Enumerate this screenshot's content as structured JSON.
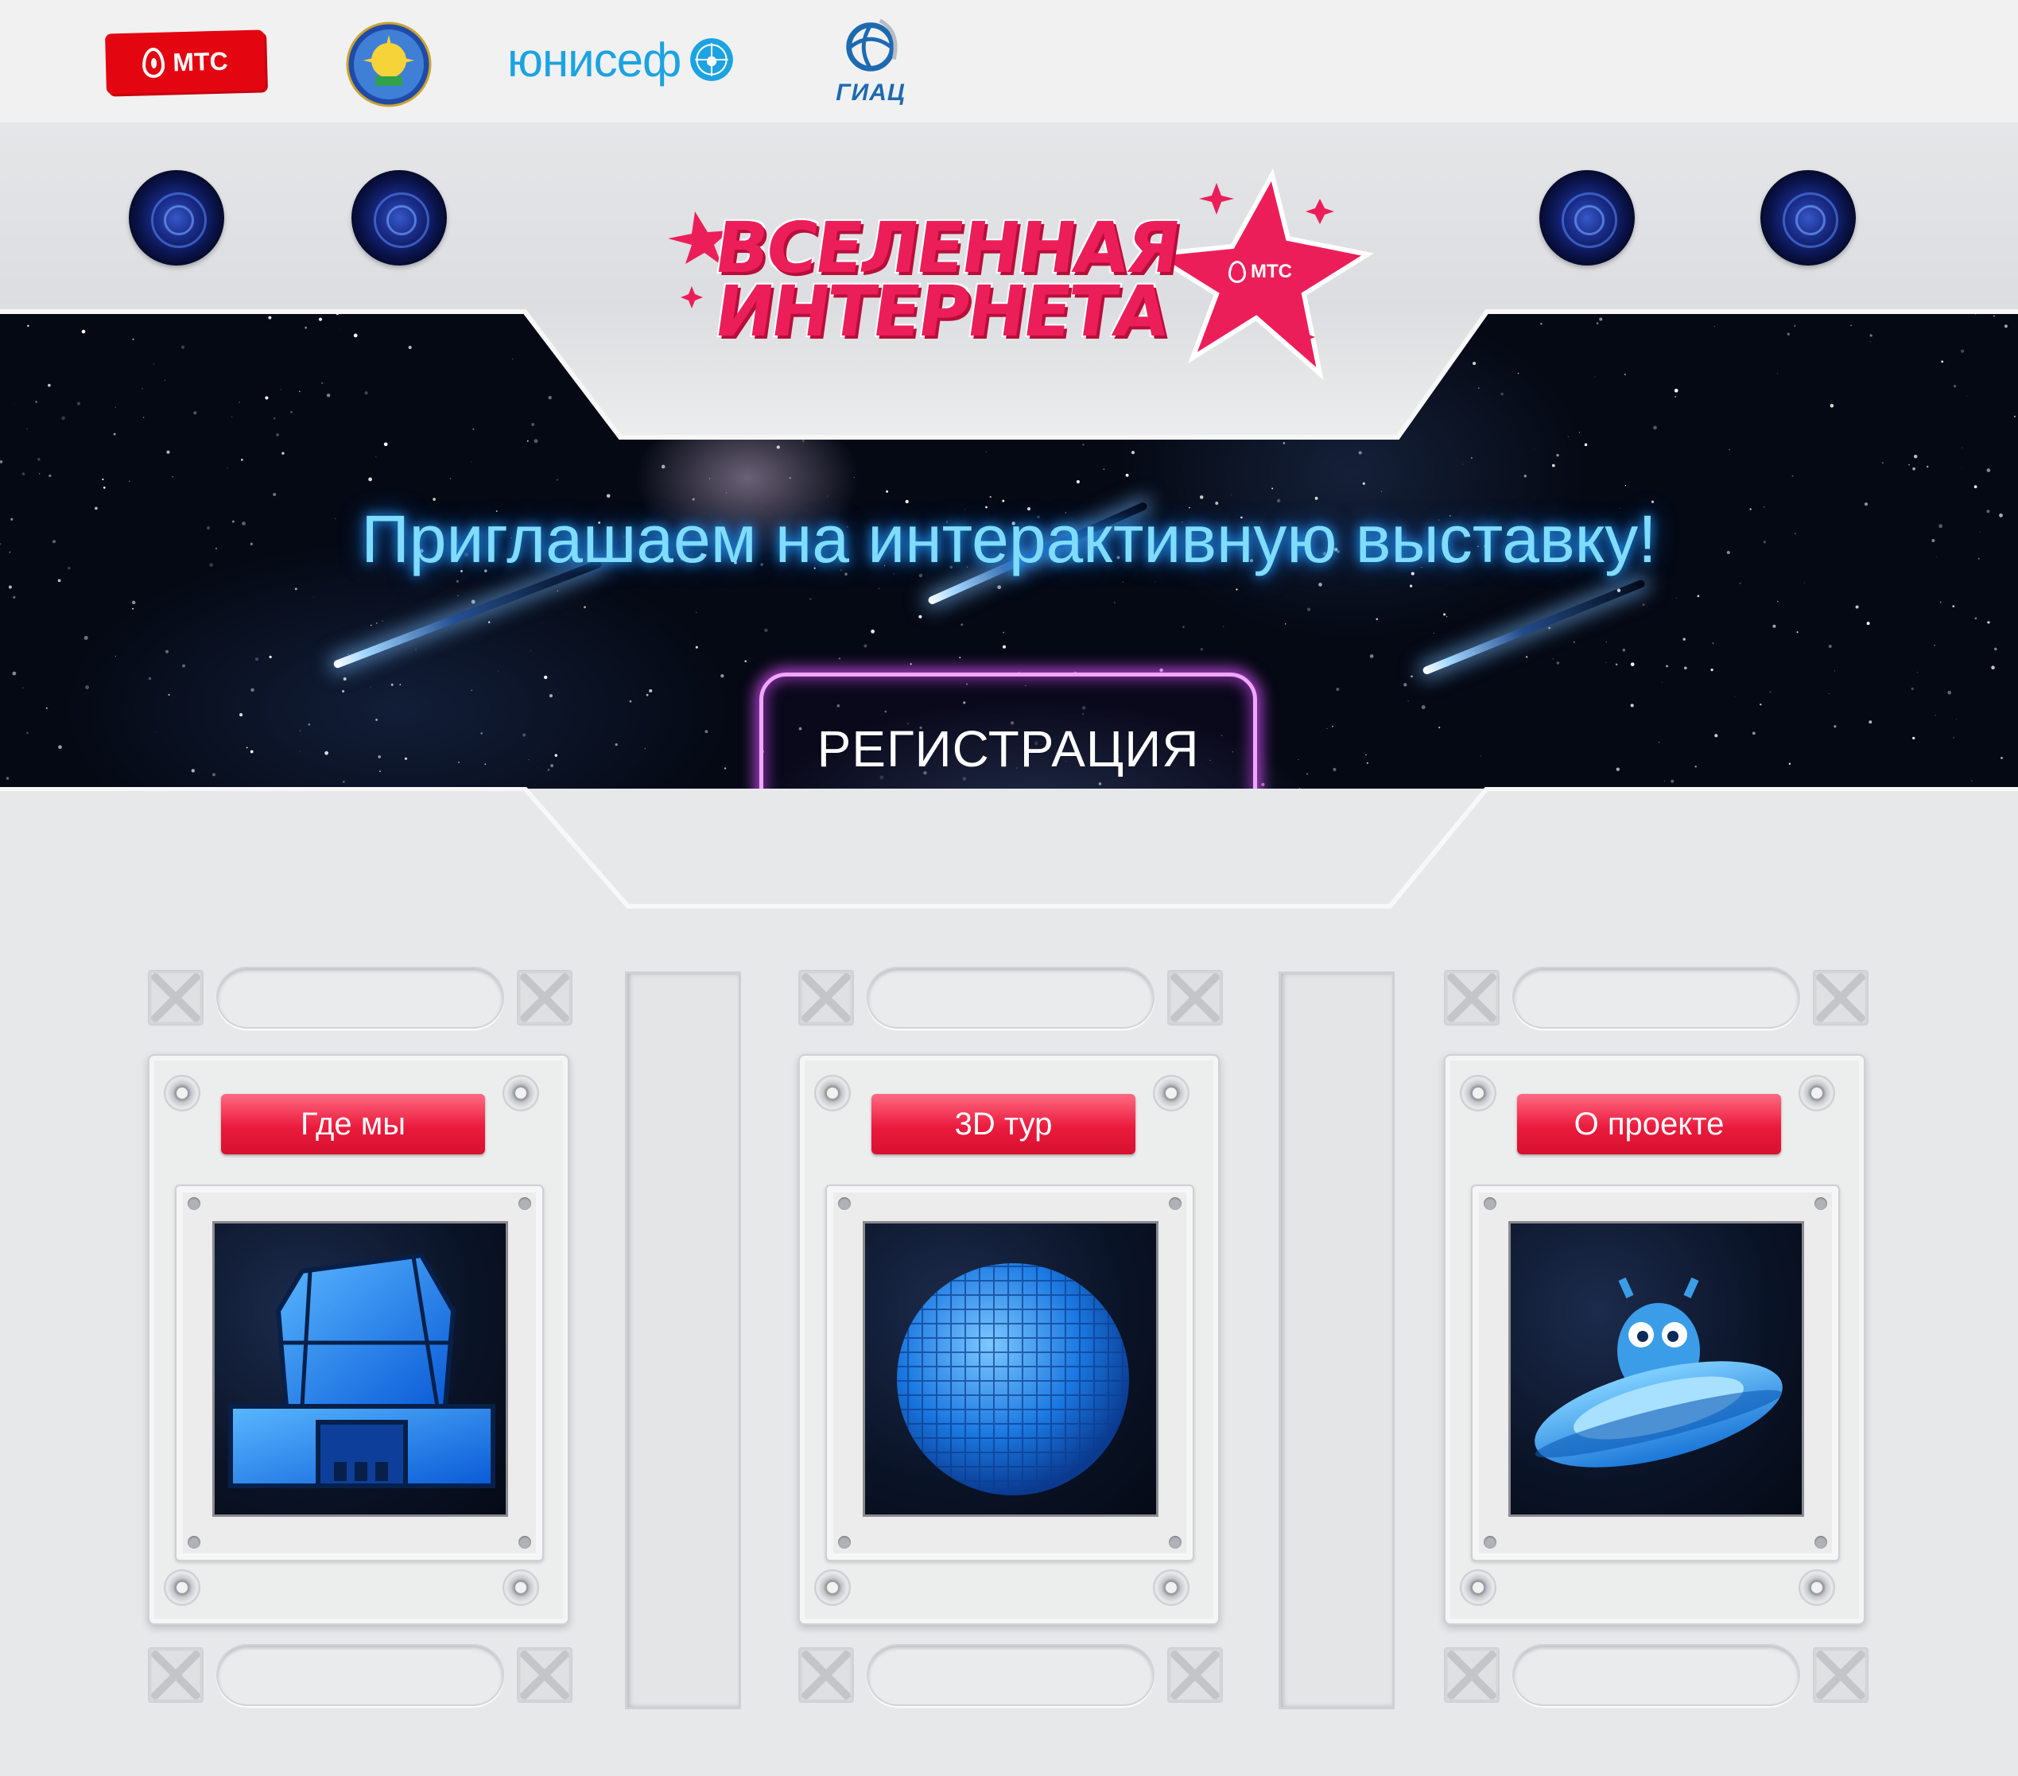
{
  "partners": {
    "mts": {
      "text": "МТС"
    },
    "seal": {
      "name": "ministry-seal"
    },
    "unicef": {
      "text": "юнисеф"
    },
    "giac": {
      "text": "ГИАЦ"
    }
  },
  "header": {
    "logo_line1": "ВСЕЛЕННАЯ",
    "logo_line2": "ИНТЕРНЕТА",
    "logo_badge": "МТС"
  },
  "hero": {
    "invite": "Приглашаем на интерактивную выставку!",
    "register_label": "РЕГИСТРАЦИЯ"
  },
  "cards": [
    {
      "label": "Где мы",
      "icon": "building-icon"
    },
    {
      "label": "3D тур",
      "icon": "cube-sphere-icon"
    },
    {
      "label": "О проекте",
      "icon": "alien-ufo-icon"
    }
  ],
  "colors": {
    "accent": "#ea1b3d",
    "mts_red": "#e30611",
    "unicef_blue": "#1ca3e1",
    "neon_blue": "#7fdcff",
    "neon_pink": "#f0a6ff"
  }
}
